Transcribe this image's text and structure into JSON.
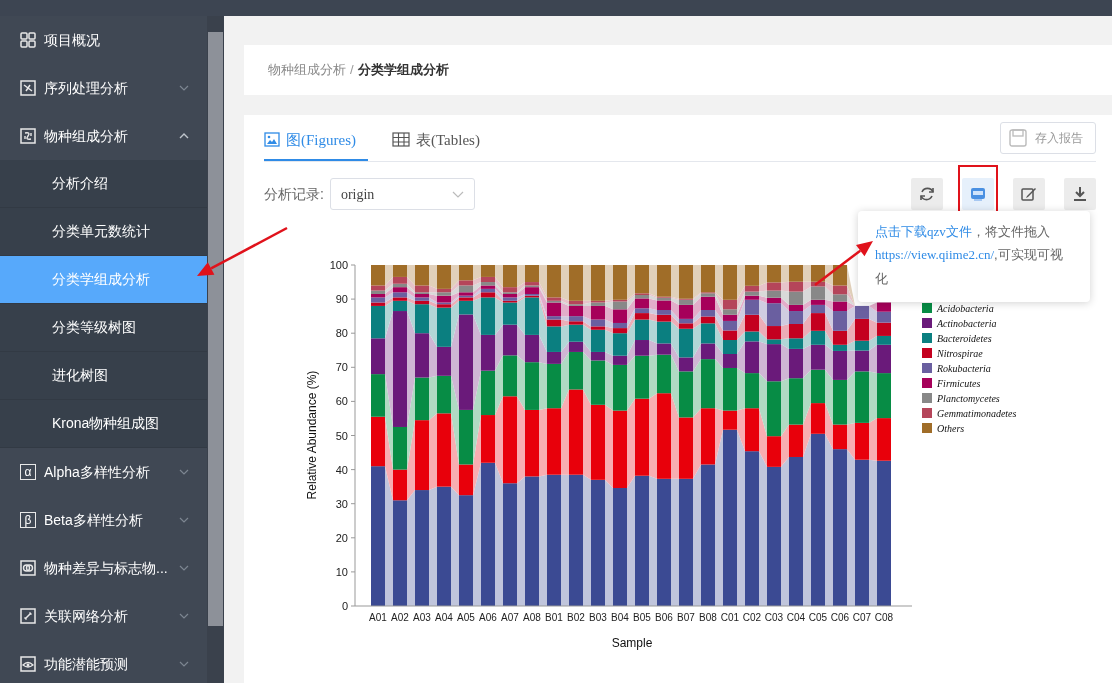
{
  "sidebar": {
    "items": [
      {
        "label": "项目概况",
        "kind": "group"
      },
      {
        "label": "序列处理分析",
        "kind": "group",
        "expanded": false
      },
      {
        "label": "物种组成分析",
        "kind": "group",
        "expanded": true
      },
      {
        "label": "分析介绍",
        "kind": "child",
        "selected": false
      },
      {
        "label": "分类单元数统计",
        "kind": "child",
        "selected": false
      },
      {
        "label": "分类学组成分析",
        "kind": "child",
        "selected": true
      },
      {
        "label": "分类等级树图",
        "kind": "child",
        "selected": false
      },
      {
        "label": "进化树图",
        "kind": "child",
        "selected": false
      },
      {
        "label": "Krona物种组成图",
        "kind": "child",
        "selected": false
      },
      {
        "label": "Alpha多样性分析",
        "kind": "group",
        "expanded": false,
        "icon_text": "α"
      },
      {
        "label": "Beta多样性分析",
        "kind": "group",
        "expanded": false,
        "icon_text": "β"
      },
      {
        "label": "物种差异与标志物...",
        "kind": "group",
        "expanded": false
      },
      {
        "label": "关联网络分析",
        "kind": "group",
        "expanded": false
      },
      {
        "label": "功能潜能预测",
        "kind": "group",
        "expanded": false
      }
    ]
  },
  "breadcrumb": [
    "物种组成分析",
    "分类学组成分析"
  ],
  "breadcrumb_separator": "/",
  "tabs": [
    {
      "label": "图(Figures)",
      "selected": true
    },
    {
      "label": "表(Tables)",
      "selected": false
    }
  ],
  "save_button": {
    "label": "存入报告",
    "disabled": true
  },
  "record": {
    "label": "分析记录:",
    "value": "origin"
  },
  "tool_buttons": [
    {
      "kind": "refresh",
      "highlighted": false
    },
    {
      "kind": "qzv",
      "highlighted": true
    },
    {
      "kind": "edit",
      "highlighted": false
    },
    {
      "kind": "download",
      "highlighted": false
    }
  ],
  "tooltip": {
    "parts": [
      {
        "kind": "link",
        "text": "点击下载qzv文件"
      },
      {
        "kind": "text",
        "text": "，将文件拖入"
      },
      {
        "kind": "link",
        "text": "https://view.qiime2.cn/"
      },
      {
        "kind": "text",
        "text": ",可实现可视化"
      }
    ]
  },
  "chart": {
    "chart_data": {
      "type": "bar",
      "stacked": true,
      "legend": "right",
      "xlabel": "Sample",
      "ylabel": "Relative Abundance (%)",
      "ylim": [
        0,
        100
      ],
      "yticks": [
        0,
        10,
        20,
        30,
        40,
        50,
        60,
        70,
        80,
        90,
        100
      ],
      "categories": [
        "A01",
        "A02",
        "A03",
        "A04",
        "A05",
        "A06",
        "A07",
        "A08",
        "B01",
        "B02",
        "B03",
        "B04",
        "B05",
        "B06",
        "B07",
        "B08",
        "C01",
        "C02",
        "C03",
        "C04",
        "C05",
        "C06",
        "C07",
        "C08"
      ],
      "series": [
        {
          "color": "#3b4a93",
          "values": [
            41,
            31,
            34,
            35,
            32.5,
            42,
            36,
            38,
            38.5,
            38.5,
            37,
            34.6,
            38.2,
            37.3,
            37.3,
            41.5,
            51.7,
            45.4,
            40.8,
            43.7,
            50.5,
            46,
            42.9,
            42.6
          ]
        },
        {
          "color": "#e8000b",
          "values": [
            14.5,
            9,
            20.5,
            21.5,
            9,
            14,
            25.5,
            19.5,
            19.5,
            25,
            22,
            22.7,
            22.6,
            25.1,
            18,
            16.5,
            5.6,
            12.6,
            9,
            9.5,
            9,
            7.2,
            10.8,
            12.5
          ]
        },
        {
          "name": "Acidobacteria",
          "color": "#078c45",
          "values": [
            12.5,
            12.5,
            12.5,
            11,
            16,
            13,
            12,
            14,
            13,
            11,
            13,
            13.4,
            12.6,
            11.3,
            13.5,
            14.4,
            12.5,
            10.3,
            16.1,
            13.6,
            9.8,
            13.1,
            15.1,
            13.2
          ]
        },
        {
          "name": "Actinobacteria",
          "color": "#6a1a7a",
          "values": [
            10.5,
            34,
            13,
            8.5,
            28,
            10.5,
            9,
            8,
            3.5,
            3,
            2.5,
            2.7,
            4.6,
            3.3,
            4.1,
            4.6,
            4.1,
            9.3,
            10.9,
            8.6,
            7.3,
            8.5,
            6.1,
            8.3
          ]
        },
        {
          "name": "Bacteroidetes",
          "color": "#0b7f80",
          "values": [
            9.5,
            3,
            8.5,
            11.5,
            4,
            11,
            6.5,
            11,
            7.5,
            5,
            6.5,
            6.6,
            6,
            6.4,
            8.4,
            5.9,
            4.1,
            2.9,
            1.4,
            3.1,
            4.1,
            1.8,
            2.9,
            2.6
          ]
        },
        {
          "name": "Nitrospirae",
          "color": "#c4001f",
          "values": [
            1,
            1,
            1,
            1,
            1,
            1.5,
            0.5,
            0.5,
            2,
            1,
            1,
            1.5,
            1.9,
            2,
            1.6,
            2,
            2.8,
            4.9,
            3.9,
            4.2,
            5.2,
            4.1,
            6.4,
            3.9
          ]
        },
        {
          "name": "Rokubacteria",
          "color": "#6a5fa0",
          "values": [
            1.5,
            1.5,
            1,
            0.5,
            0.5,
            1,
            1,
            0.5,
            1,
            1.5,
            2,
            1.5,
            1.4,
            1.4,
            1.3,
            1.9,
            2.8,
            4.4,
            6.7,
            3.8,
            2.4,
            5.8,
            3.8,
            3.2
          ]
        },
        {
          "name": "Firmicutes",
          "color": "#a6005a",
          "values": [
            1,
            1.5,
            1,
            2,
            1,
            1,
            1,
            2,
            4,
            3,
            4,
            4,
            2.9,
            2.8,
            4.1,
            3.9,
            1.8,
            1.2,
            1.6,
            1.8,
            1.5,
            2.8,
            null,
            2.7
          ]
        },
        {
          "name": "Planctomycetes",
          "color": "#888888",
          "values": [
            1,
            1,
            0.5,
            1,
            2,
            1,
            0.5,
            0.5,
            0.5,
            0.5,
            1,
            2.3,
            1,
            0.8,
            1.5,
            1,
            1.6,
            1.2,
            2.1,
            3.9,
            3.9,
            2.1,
            null,
            null
          ]
        },
        {
          "name": "Gemmatimonadetes",
          "color": "#b5455a",
          "values": [
            1.5,
            2,
            2,
            1,
            1.5,
            1.5,
            1.5,
            1,
            1,
            1,
            0.5,
            0.5,
            0.5,
            0.3,
            0.3,
            0.3,
            2.8,
            1.7,
            2.4,
            2.9,
            1.4,
            2.6,
            null,
            null
          ]
        },
        {
          "name": "Others",
          "color": "#a06d28",
          "values": [
            6,
            3.5,
            6,
            7,
            4.5,
            3.5,
            6.5,
            5,
            9.5,
            10.5,
            10.5,
            10.2,
            8.3,
            9.3,
            9.9,
            8,
            10.2,
            6.1,
            5.1,
            4.9,
            4.9,
            6,
            null,
            null
          ]
        }
      ]
    }
  }
}
